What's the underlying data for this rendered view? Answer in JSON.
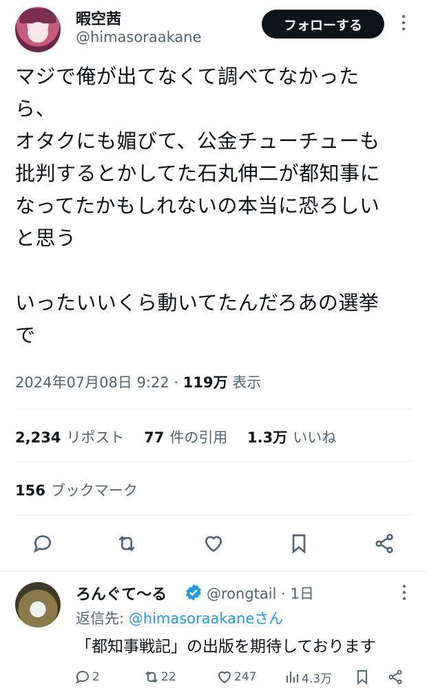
{
  "author": {
    "display_name": "暇空茜",
    "handle": "@himasoraakane",
    "avatar_icon": "avatar-anime-girl"
  },
  "follow_label": "フォローする",
  "tweet": {
    "text": "マジで俺が出てなくて調べてなかった\nら、\nオタクにも媚びて、公金チューチューも\n批判するとかしてた石丸伸二が都知事に\nなってたかもしれないの本当に恐ろしい\nと思う\n\nいったいいくら動いてたんだろあの選挙\nで",
    "timestamp": "2024年07月08日 9:22 · ",
    "views_count": "119万",
    "views_label": " 表示"
  },
  "stats": {
    "reposts_count": "2,234",
    "reposts_label": "リポスト",
    "quotes_count": "77",
    "quotes_label": "件の引用",
    "likes_count": "1.3万",
    "likes_label": "いいね",
    "bookmarks_count": "156",
    "bookmarks_label": "ブックマーク"
  },
  "reply": {
    "display_name": "ろんぐて〜る",
    "handle_time": "@rongtail · 1日",
    "reply_to_prefix": "返信先: ",
    "reply_to_mention": "@himasoraakaneさん",
    "text": "「都知事戦記」の出版を期待しております",
    "replies": "2",
    "reposts": "22",
    "likes": "247",
    "views": "4.3万",
    "verified_color": "#1d9bf0"
  },
  "colors": {
    "text": "#0f1419",
    "secondary": "#536471",
    "accent": "#1d9bf0",
    "divider": "#eff3f4"
  }
}
